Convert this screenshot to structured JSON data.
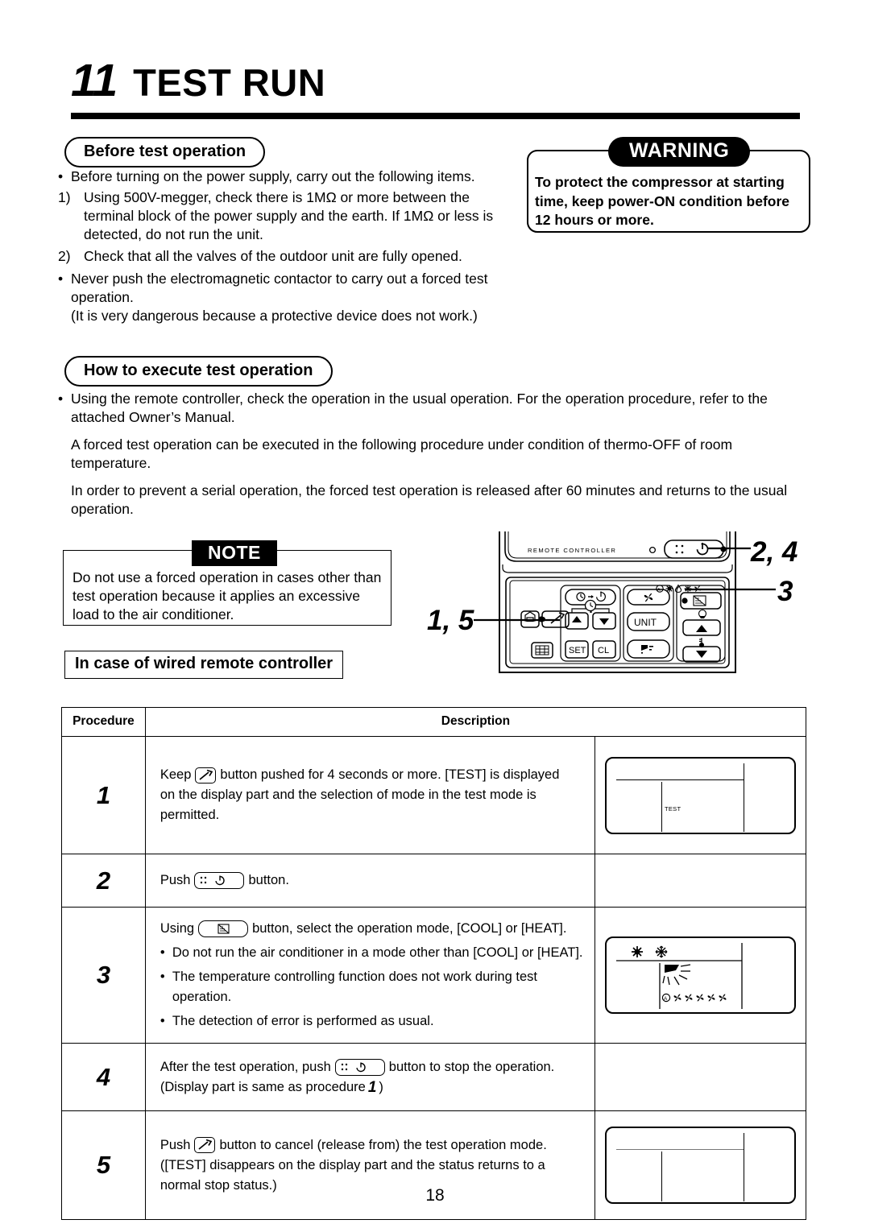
{
  "chapter": {
    "number": "11",
    "title": "TEST RUN"
  },
  "sections": {
    "before": {
      "heading": "Before test operation",
      "bullet1": "Before turning on the power supply, carry out the following items.",
      "item1_label": "1)",
      "item1_text": "Using 500V-megger, check there is 1MΩ or more between the terminal block of the power supply and the earth. If 1MΩ or less is detected, do not run the unit.",
      "item2_label": "2)",
      "item2_text": "Check that all the valves of the outdoor unit are fully opened.",
      "bullet2": "Never push the electromagnetic contactor to carry out a forced test operation.",
      "bullet2_tail": "(It is very dangerous because a protective device does not work.)"
    },
    "warning": {
      "label": "WARNING",
      "text": "To protect the compressor at starting time, keep power-ON condition before 12 hours or more."
    },
    "howto": {
      "heading": "How to execute test operation",
      "bullet1": "Using the remote controller, check the operation in the usual operation. For the operation procedure, refer to the attached Owner’s Manual.",
      "para1": "A forced test operation can be executed in the following procedure under condition of thermo-OFF of room temperature.",
      "para2": "In order to prevent a serial operation, the forced test operation is released after 60 minutes and returns to the usual operation."
    },
    "note": {
      "label": "NOTE",
      "text": "Do not use a forced operation in cases other than test operation because it applies an excessive load to the air conditioner."
    },
    "wired": {
      "heading": "In case of wired remote controller"
    }
  },
  "remote_figure": {
    "device_label": "REMOTE CONTROLLER",
    "buttons": {
      "unit": "UNIT",
      "set": "SET",
      "cl": "CL"
    },
    "callouts": {
      "left": "1, 5",
      "top_right": "2, 4",
      "right": "3"
    }
  },
  "table": {
    "headers": {
      "procedure": "Procedure",
      "description": "Description"
    },
    "rows": [
      {
        "num": "1",
        "line1_pre": "Keep",
        "line1_post": "button pushed for 4 seconds or more.  [TEST] is displayed",
        "line2": "on the display part and the selection of mode in the test mode is",
        "line3": "permitted.",
        "display": {
          "text": "TEST"
        }
      },
      {
        "num": "2",
        "line1_pre": "Push",
        "line1_post": "button.",
        "display": null
      },
      {
        "num": "3",
        "line1_pre": "Using",
        "line1_post": "button, select the operation mode, [COOL] or [HEAT].",
        "sub1": "Do not run the air conditioner in a mode other than [COOL] or [HEAT].",
        "sub2": "The temperature controlling function does not work during test operation.",
        "sub3": "The detection of error is performed as usual.",
        "display": {
          "icons": "sun-snowflake"
        }
      },
      {
        "num": "4",
        "line1_pre": "After the test operation, push",
        "line1_post": "button to stop the operation.",
        "line2_pre": "(Display part is same as procedure",
        "line2_ref": "1",
        "line2_post": ")",
        "display": null
      },
      {
        "num": "5",
        "line1_pre": "Push",
        "line1_post": "button to cancel (release from) the test operation mode.",
        "line2": "([TEST] disappears on the display part and the status returns to a",
        "line3": "normal stop status.)",
        "display": {
          "text": ""
        }
      }
    ]
  },
  "page_number": "18"
}
